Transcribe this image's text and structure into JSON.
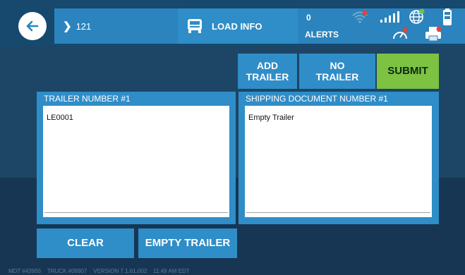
{
  "header": {
    "trip_number": "121",
    "load_info_label": "LOAD INFO",
    "alerts_count": "0",
    "alerts_label": "ALERTS",
    "icons": {
      "back": "back-arrow-icon",
      "chevron": "chevron-right-icon",
      "truck": "truck-icon",
      "wifi": "wifi-off-icon",
      "signal": "signal-bars-icon",
      "globe": "globe-icon",
      "battery": "battery-icon",
      "gauge": "gauge-icon",
      "printer": "printer-icon"
    }
  },
  "actions": {
    "add_trailer": [
      "ADD",
      "TRAILER"
    ],
    "no_trailer": [
      "NO",
      "TRAILER"
    ],
    "submit": "SUBMIT"
  },
  "trailer": {
    "title": "TRAILER NUMBER #1",
    "value": "LE0001"
  },
  "shipping": {
    "title": "SHIPPING DOCUMENT NUMBER #1",
    "value": "Empty Trailer"
  },
  "bottom_buttons": {
    "clear": "CLEAR",
    "empty_trailer": "EMPTY TRAILER"
  },
  "footer": {
    "mdt": "MDT #43955",
    "truck": "TRUCK #09907",
    "version": "VERSION  7.1.61.002",
    "time": "11:49 AM EDT"
  },
  "colors": {
    "background": "#1d4565",
    "header_bar": "#2b84bd",
    "panel": "#2f8dc7",
    "submit": "#7dc242"
  }
}
